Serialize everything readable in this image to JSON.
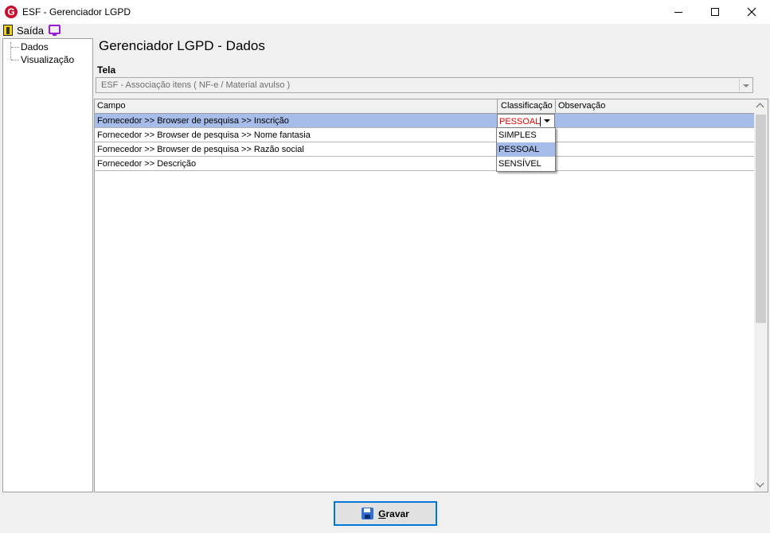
{
  "window": {
    "title": "ESF - Gerenciador LGPD",
    "app_icon_letter": "G",
    "accent_color": "#c8102e"
  },
  "menubar": {
    "exit_label": "Saída",
    "icons": [
      "exit-door-icon",
      "monitor-icon"
    ]
  },
  "tree": {
    "items": [
      {
        "label": "Dados"
      },
      {
        "label": "Visualização"
      }
    ]
  },
  "main": {
    "title": "Gerenciador LGPD - Dados",
    "tela_label": "Tela",
    "tela_value": "ESF - Associação itens ( NF-e / Material avulso )"
  },
  "grid": {
    "columns": [
      "Campo",
      "Classificação",
      "Observação"
    ],
    "rows": [
      {
        "campo": "Fornecedor >> Browser de pesquisa >> Inscrição",
        "classificacao": "PESSOAL",
        "observacao": "",
        "selected": true
      },
      {
        "campo": "Fornecedor >> Browser de pesquisa >> Nome fantasia",
        "classificacao": "",
        "observacao": ""
      },
      {
        "campo": "Fornecedor >> Browser de pesquisa >> Razão social",
        "classificacao": "",
        "observacao": ""
      },
      {
        "campo": "Fornecedor >> Descrição",
        "classificacao": "",
        "observacao": ""
      }
    ],
    "selection_color": "#a7bde9",
    "edit_value_color": "#e00000"
  },
  "dropdown": {
    "options": [
      "SIMPLES",
      "PESSOAL",
      "SENSÍVEL"
    ],
    "highlighted": "PESSOAL"
  },
  "footer": {
    "save_label": "Gravar",
    "save_accelerator": "G"
  }
}
